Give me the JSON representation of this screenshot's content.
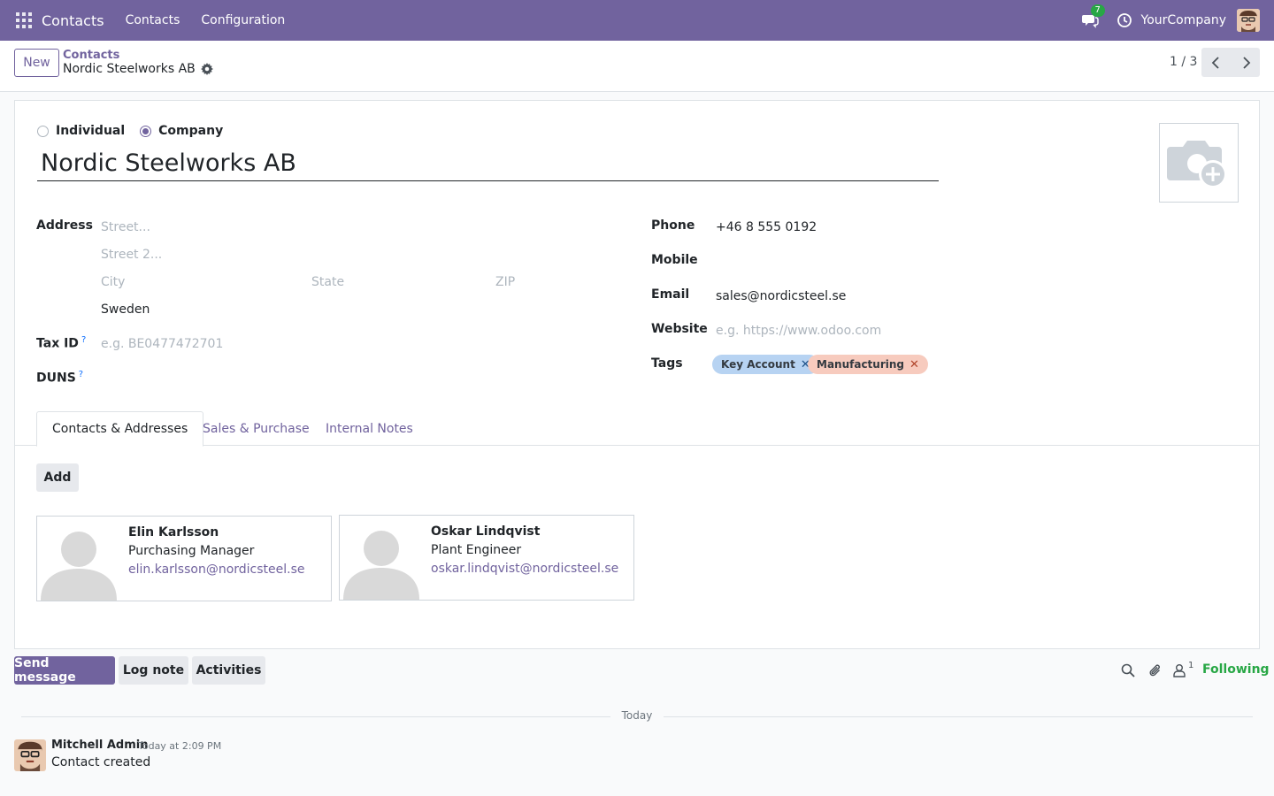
{
  "navbar": {
    "app_name": "Contacts",
    "menu": [
      "Contacts",
      "Configuration"
    ],
    "messages_count": "7",
    "company": "YourCompany"
  },
  "control": {
    "new_label": "New",
    "breadcrumb_parent": "Contacts",
    "breadcrumb_current": "Nordic Steelworks AB",
    "pager": "1 / 3"
  },
  "form": {
    "type_options": [
      "Individual",
      "Company"
    ],
    "type_selected": "Company",
    "name": "Nordic Steelworks AB",
    "labels": {
      "address": "Address",
      "tax_id": "Tax ID",
      "duns": "DUNS",
      "phone": "Phone",
      "mobile": "Mobile",
      "email": "Email",
      "website": "Website",
      "tags": "Tags",
      "help_mark": "?"
    },
    "placeholders": {
      "street": "Street...",
      "street2": "Street 2...",
      "city": "City",
      "state": "State",
      "zip": "ZIP",
      "tax_id": "e.g. BE0477472701",
      "website": "e.g. https://www.odoo.com"
    },
    "values": {
      "country": "Sweden",
      "phone": "+46 8 555 0192",
      "email": "sales@nordicsteel.se"
    },
    "tags": [
      {
        "label": "Key Account",
        "color": "#b7d3f2"
      },
      {
        "label": "Manufacturing",
        "color": "#f7cbbe"
      }
    ]
  },
  "tabs": [
    "Contacts & Addresses",
    "Sales & Purchase",
    "Internal Notes"
  ],
  "active_tab": "Contacts & Addresses",
  "contacts": {
    "add_label": "Add",
    "cards": [
      {
        "name": "Elin Karlsson",
        "job": "Purchasing Manager",
        "email": "elin.karlsson@nordicsteel.se"
      },
      {
        "name": "Oskar Lindqvist",
        "job": "Plant Engineer",
        "email": "oskar.lindqvist@nordicsteel.se"
      }
    ]
  },
  "chatter": {
    "send_message": "Send message",
    "log_note": "Log note",
    "activities": "Activities",
    "followers_count": "1",
    "following": "Following",
    "date_separator": "Today",
    "message": {
      "author": "Mitchell Admin",
      "time": "Today at 2:09 PM",
      "body": "Contact created"
    }
  },
  "colors": {
    "brand": "#71639e",
    "success": "#28a745"
  }
}
